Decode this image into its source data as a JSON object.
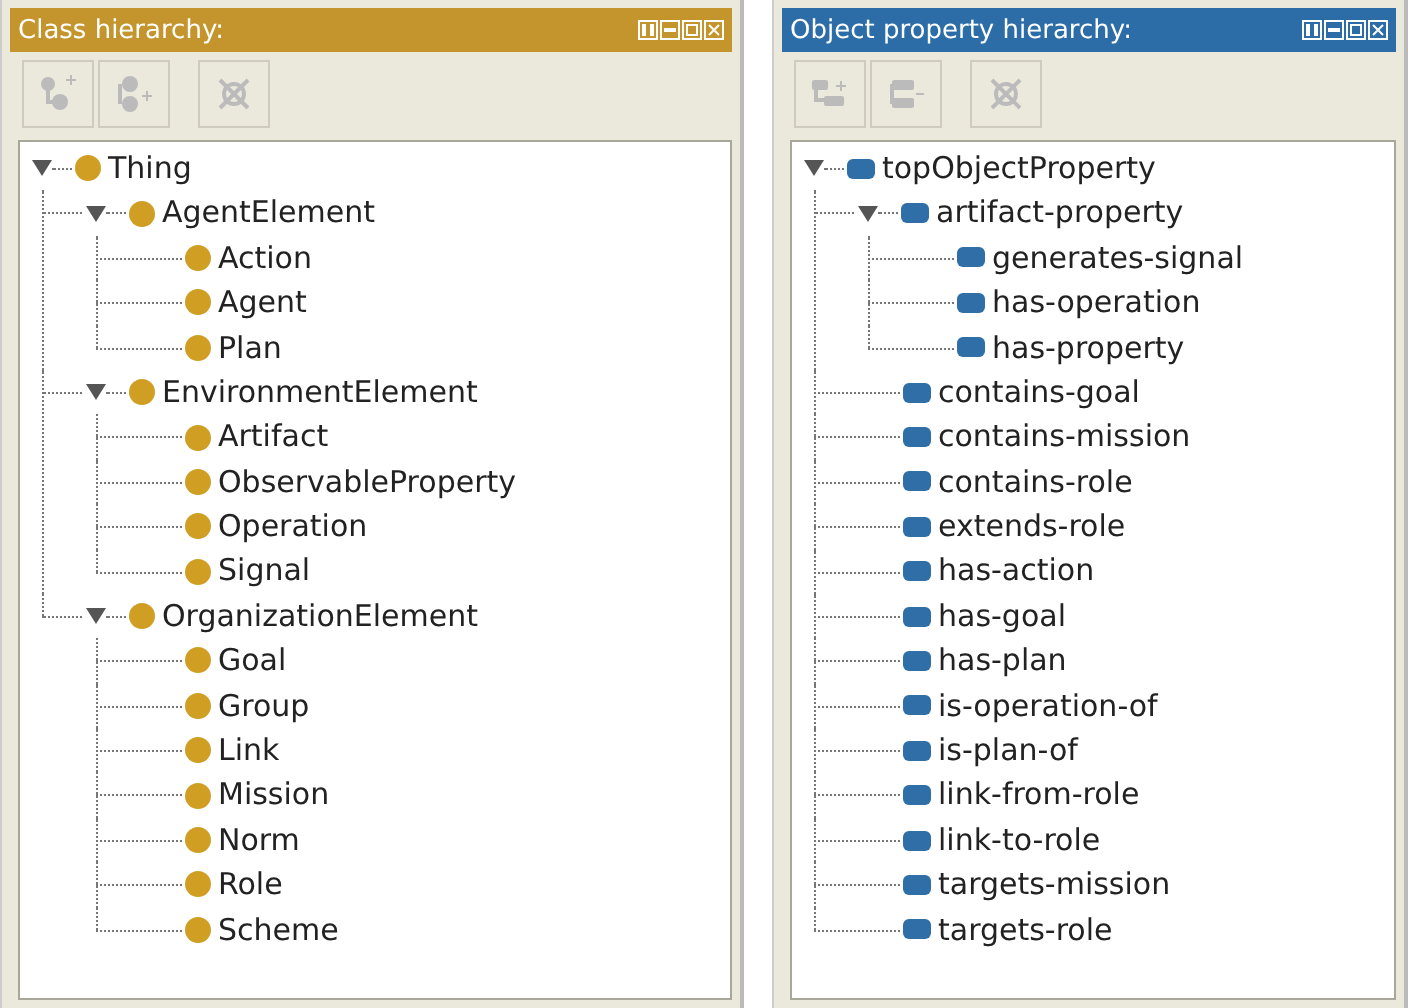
{
  "panels": [
    {
      "kind": "class",
      "title": "Class hierarchy:",
      "tree": [
        {
          "label": "Thing",
          "expanded": true,
          "children": [
            {
              "label": "AgentElement",
              "expanded": true,
              "children": [
                {
                  "label": "Action"
                },
                {
                  "label": "Agent"
                },
                {
                  "label": "Plan"
                }
              ]
            },
            {
              "label": "EnvironmentElement",
              "expanded": true,
              "children": [
                {
                  "label": "Artifact"
                },
                {
                  "label": "ObservableProperty"
                },
                {
                  "label": "Operation"
                },
                {
                  "label": "Signal"
                }
              ]
            },
            {
              "label": "OrganizationElement",
              "expanded": true,
              "children": [
                {
                  "label": "Goal"
                },
                {
                  "label": "Group"
                },
                {
                  "label": "Link"
                },
                {
                  "label": "Mission"
                },
                {
                  "label": "Norm"
                },
                {
                  "label": "Role"
                },
                {
                  "label": "Scheme"
                }
              ]
            }
          ]
        }
      ]
    },
    {
      "kind": "property",
      "title": "Object property hierarchy:",
      "tree": [
        {
          "label": "topObjectProperty",
          "expanded": true,
          "children": [
            {
              "label": "artifact-property",
              "expanded": true,
              "children": [
                {
                  "label": "generates-signal"
                },
                {
                  "label": "has-operation"
                },
                {
                  "label": "has-property"
                }
              ]
            },
            {
              "label": "contains-goal"
            },
            {
              "label": "contains-mission"
            },
            {
              "label": "contains-role"
            },
            {
              "label": "extends-role"
            },
            {
              "label": "has-action"
            },
            {
              "label": "has-goal"
            },
            {
              "label": "has-plan"
            },
            {
              "label": "is-operation-of"
            },
            {
              "label": "is-plan-of"
            },
            {
              "label": "link-from-role"
            },
            {
              "label": "link-to-role"
            },
            {
              "label": "targets-mission"
            },
            {
              "label": "targets-role"
            }
          ]
        }
      ]
    }
  ]
}
